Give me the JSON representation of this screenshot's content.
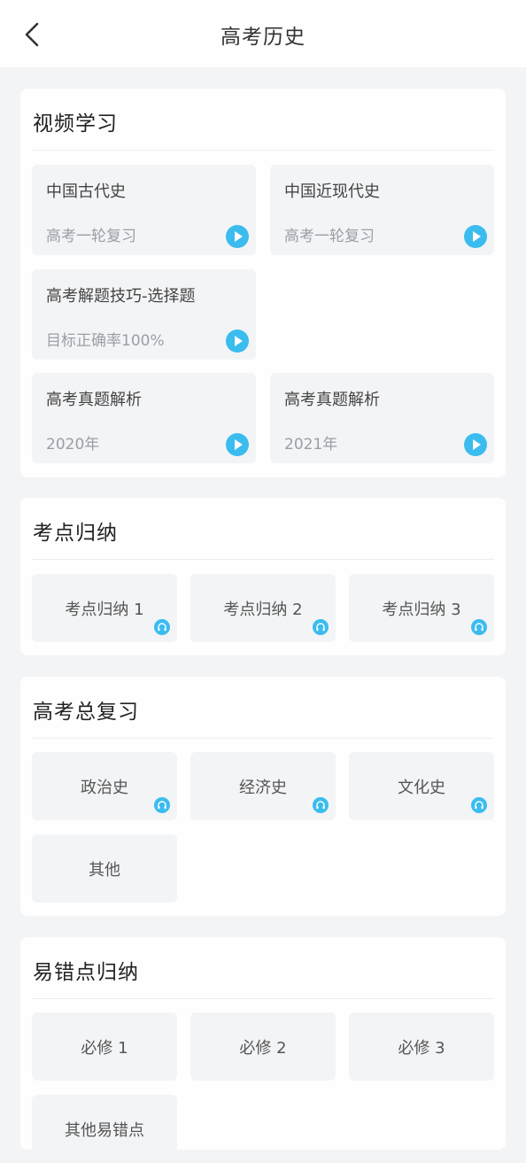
{
  "header": {
    "title": "高考历史"
  },
  "video_section": {
    "title": "视频学习",
    "items": [
      {
        "name": "中国古代史",
        "sub": "高考一轮复习"
      },
      {
        "name": "中国近现代史",
        "sub": "高考一轮复习"
      },
      {
        "name": "高考解题技巧-选择题",
        "sub": "目标正确率100%"
      },
      {
        "name": "高考真题解析",
        "sub": "2020年"
      },
      {
        "name": "高考真题解析",
        "sub": "2021年"
      }
    ]
  },
  "kaodian_section": {
    "title": "考点归纳",
    "items": [
      "考点归纳 1",
      "考点归纳 2",
      "考点归纳 3"
    ]
  },
  "review_section": {
    "title": "高考总复习",
    "items": [
      "政治史",
      "经济史",
      "文化史",
      "其他"
    ]
  },
  "mistakes_section": {
    "title": "易错点归纳",
    "items": [
      "必修 1",
      "必修 2",
      "必修 3",
      "其他易错点"
    ]
  },
  "colors": {
    "accent": "#3bbcef",
    "page_bg": "#f3f4f6",
    "tile_bg": "#f3f4f6"
  }
}
